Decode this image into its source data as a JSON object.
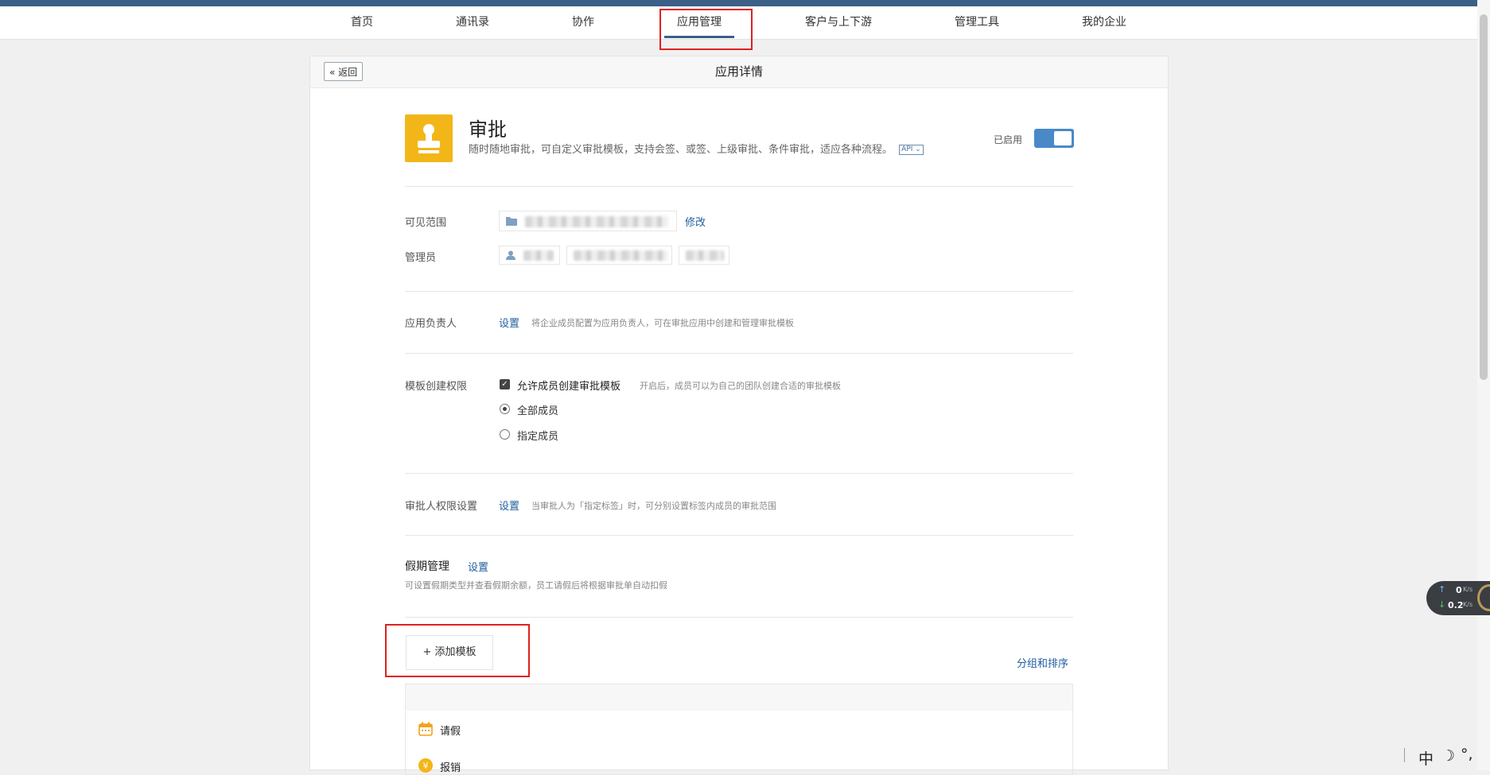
{
  "nav": {
    "items": [
      "首页",
      "通讯录",
      "协作",
      "应用管理",
      "客户与上下游",
      "管理工具",
      "我的企业"
    ],
    "active": "应用管理"
  },
  "header": {
    "back_label": "返回",
    "title": "应用详情"
  },
  "app": {
    "name": "审批",
    "description": "随时随地审批，可自定义审批模板，支持会签、或签、上级审批、条件审批，适应各种流程。",
    "api_badge": "API",
    "enabled_label": "已启用",
    "enabled": true,
    "icon_color": "#f3b619"
  },
  "visibility": {
    "label": "可见范围",
    "edit_link": "修改"
  },
  "admins": {
    "label": "管理员"
  },
  "owner": {
    "label": "应用负责人",
    "link": "设置",
    "desc": "将企业成员配置为应用负责人，可在审批应用中创建和管理审批模板"
  },
  "template_permission": {
    "label": "模板创建权限",
    "checkbox_label": "允许成员创建审批模板",
    "checked": true,
    "checkbox_desc": "开启后，成员可以为自己的团队创建合适的审批模板",
    "options": [
      {
        "label": "全部成员",
        "selected": true
      },
      {
        "label": "指定成员",
        "selected": false
      }
    ]
  },
  "approver_permission": {
    "label": "审批人权限设置",
    "link": "设置",
    "desc": "当审批人为「指定标签」时，可分别设置标签内成员的审批范围"
  },
  "leave": {
    "title": "假期管理",
    "link": "设置",
    "desc": "可设置假期类型并查看假期余额，员工请假后将根据审批单自动扣假"
  },
  "templates": {
    "add_label": "+ 添加模板",
    "sort_link": "分组和排序",
    "items": [
      {
        "name": "请假",
        "icon": "calendar-icon"
      },
      {
        "name": "报销",
        "icon": "yen-coin-icon"
      }
    ]
  },
  "network_widget": {
    "up": "0",
    "down": "0.2",
    "unit": "K/s"
  },
  "ime": {
    "lang": "中"
  },
  "colors": {
    "accent": "#3b5f86",
    "link": "#1f5e9e",
    "highlight_box": "#e02020"
  }
}
